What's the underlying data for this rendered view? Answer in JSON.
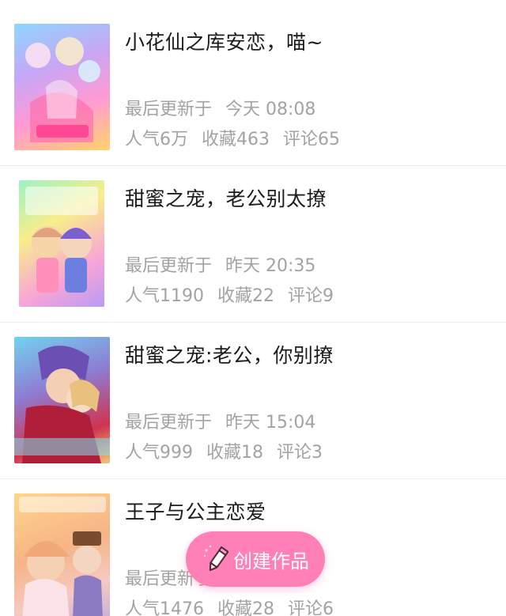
{
  "works": [
    {
      "title": "小花仙之库安恋，喵~",
      "updated_label": "最后更新于",
      "updated_time": "今天 08:08",
      "popularity": "人气6万",
      "favorites": "收藏463",
      "comments": "评论65"
    },
    {
      "title": "甜蜜之宠，老公别太撩",
      "updated_label": "最后更新于",
      "updated_time": "昨天 20:35",
      "popularity": "人气1190",
      "favorites": "收藏22",
      "comments": "评论9"
    },
    {
      "title": "甜蜜之宠:老公，你别撩",
      "updated_label": "最后更新于",
      "updated_time": "昨天 15:04",
      "popularity": "人气999",
      "favorites": "收藏18",
      "comments": "评论3"
    },
    {
      "title": "王子与公主恋爱",
      "updated_label": "最后更新于",
      "updated_time": "",
      "popularity": "人气1476",
      "favorites": "收藏28",
      "comments": "评论6"
    }
  ],
  "fab": {
    "label": "创建作品",
    "icon": "pencil-icon",
    "color": "#ff7fb7"
  }
}
